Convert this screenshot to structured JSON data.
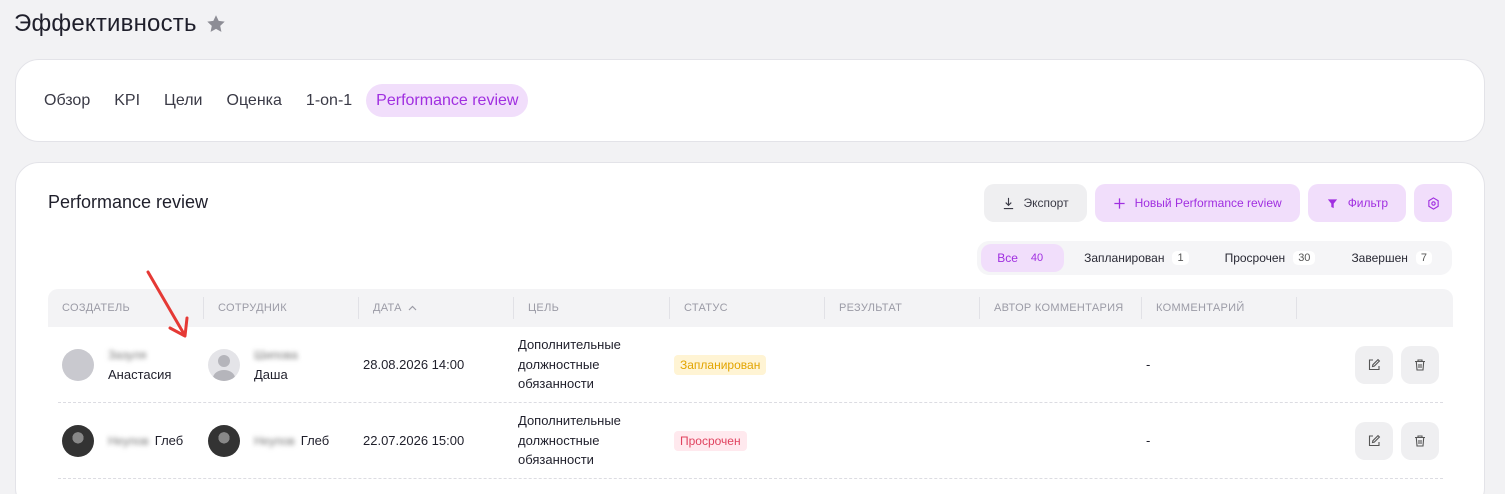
{
  "page": {
    "title": "Эффективность",
    "favorite_icon": "star-icon"
  },
  "tabs": [
    {
      "label": "Обзор",
      "active": false
    },
    {
      "label": "KPI",
      "active": false
    },
    {
      "label": "Цели",
      "active": false
    },
    {
      "label": "Оценка",
      "active": false
    },
    {
      "label": "1-on-1",
      "active": false
    },
    {
      "label": "Performance review",
      "active": true
    }
  ],
  "section": {
    "title": "Performance review"
  },
  "toolbar": {
    "export_label": "Экспорт",
    "new_label": "Новый Performance review",
    "filter_label": "Фильтр",
    "settings_icon": "settings-icon"
  },
  "status_filter": [
    {
      "label": "Все",
      "count": "40",
      "active": true
    },
    {
      "label": "Запланирован",
      "count": "1",
      "active": false
    },
    {
      "label": "Просрочен",
      "count": "30",
      "active": false
    },
    {
      "label": "Завершен",
      "count": "7",
      "active": false
    }
  ],
  "table": {
    "headers": [
      "Создатель",
      "Сотрудник",
      "Дата",
      "Цель",
      "Статус",
      "Результат",
      "Автор комментария",
      "Комментарий"
    ],
    "rows": [
      {
        "creator_surname": "Зазуля",
        "creator_name": "Анастасия",
        "employee_surname": "Шипова",
        "employee_name": "Даша",
        "date": "28.08.2026 14:00",
        "goal": [
          "Дополнительные",
          "должностные",
          "обязанности"
        ],
        "status": "Запланирован",
        "result": "",
        "comment_author": "",
        "comment": "-"
      },
      {
        "creator_surname": "Неупов",
        "creator_name": "Глеб",
        "employee_surname": "Неупов",
        "employee_name": "Глеб",
        "date": "22.07.2026 15:00",
        "goal": [
          "Дополнительные",
          "должностные",
          "обязанности"
        ],
        "status": "Просрочен",
        "result": "",
        "comment_author": "",
        "comment": "-"
      }
    ]
  },
  "colors": {
    "accent": "#a02fe0",
    "accent_bg": "#f1defb",
    "planned": "#e2a400",
    "overdue": "#e0435f",
    "annotation_arrow": "#e53935"
  }
}
